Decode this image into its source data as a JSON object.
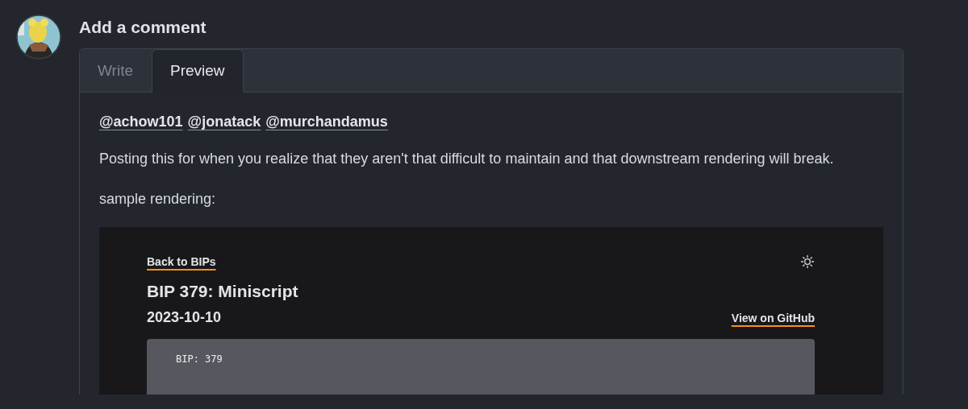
{
  "heading": "Add a comment",
  "tabs": [
    {
      "label": "Write",
      "selected": false
    },
    {
      "label": "Preview",
      "selected": true
    }
  ],
  "preview": {
    "mentions": [
      "@achow101",
      "@jonatack",
      "@murchandamus"
    ],
    "paragraphs": [
      "Posting this for when you realize that they aren't that difficult to maintain and that downstream rendering will break.",
      "sample rendering:"
    ],
    "embedded": {
      "back_link": "Back to BIPs",
      "title": "BIP 379: Miniscript",
      "date": "2023-10-10",
      "github_link": "View on GitHub",
      "code_lines": [
        "BIP: 379"
      ]
    }
  }
}
